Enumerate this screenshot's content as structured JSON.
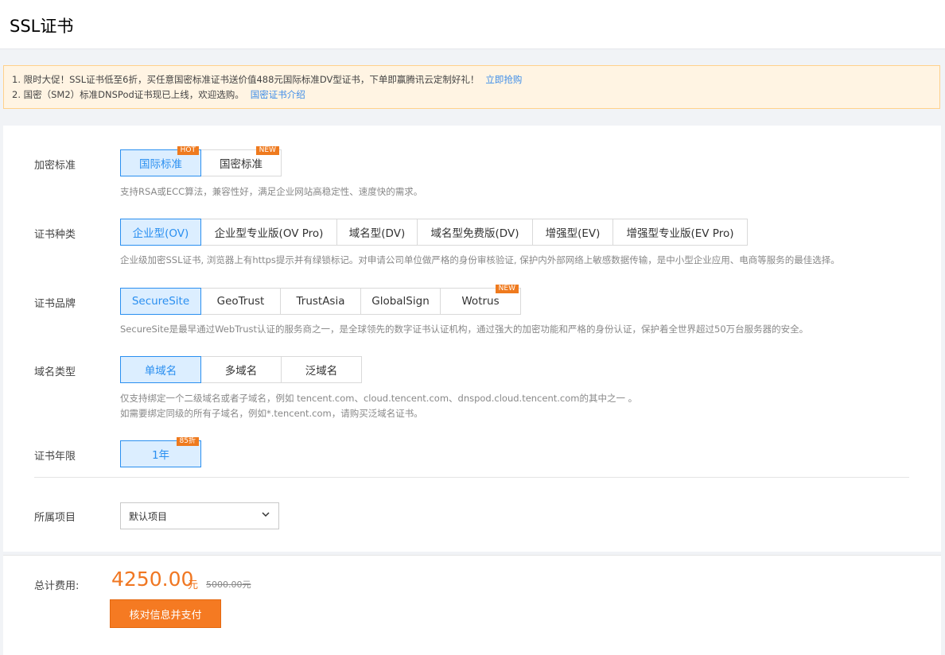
{
  "header": {
    "title": "SSL证书"
  },
  "notice": {
    "line1": "1. 限时大促！SSL证书低至6折，买任意国密标准证书送价值488元国际标准DV型证书，下单即赢腾讯云定制好礼！",
    "line1_link": "立即抢购",
    "line2": "2. 国密（SM2）标准DNSPod证书现已上线，欢迎选购。",
    "line2_link": "国密证书介绍"
  },
  "encryption": {
    "label": "加密标准",
    "options": [
      {
        "label": "国际标准",
        "tag": "HOT",
        "selected": true
      },
      {
        "label": "国密标准",
        "tag": "NEW",
        "selected": false
      }
    ],
    "desc": "支持RSA或ECC算法，兼容性好，满足企业网站高稳定性、速度快的需求。"
  },
  "cert_type": {
    "label": "证书种类",
    "options": [
      {
        "label": "企业型(OV)",
        "selected": true
      },
      {
        "label": "企业型专业版(OV Pro)",
        "selected": false
      },
      {
        "label": "域名型(DV)",
        "selected": false
      },
      {
        "label": "域名型免费版(DV)",
        "selected": false
      },
      {
        "label": "增强型(EV)",
        "selected": false
      },
      {
        "label": "增强型专业版(EV Pro)",
        "selected": false
      }
    ],
    "desc": "企业级加密SSL证书, 浏览器上有https提示并有绿锁标记。对申请公司单位做严格的身份审核验证, 保护内外部网络上敏感数据传输，是中小型企业应用、电商等服务的最佳选择。"
  },
  "brand": {
    "label": "证书品牌",
    "options": [
      {
        "label": "SecureSite",
        "selected": true
      },
      {
        "label": "GeoTrust",
        "selected": false
      },
      {
        "label": "TrustAsia",
        "selected": false
      },
      {
        "label": "GlobalSign",
        "selected": false
      },
      {
        "label": "Wotrus",
        "tag": "NEW",
        "selected": false
      }
    ],
    "desc": "SecureSite是最早通过WebTrust认证的服务商之一，是全球领先的数字证书认证机构，通过强大的加密功能和严格的身份认证，保护着全世界超过50万台服务器的安全。"
  },
  "domain_type": {
    "label": "域名类型",
    "options": [
      {
        "label": "单域名",
        "selected": true
      },
      {
        "label": "多域名",
        "selected": false
      },
      {
        "label": "泛域名",
        "selected": false
      }
    ],
    "desc1": "仅支持绑定一个二级域名或者子域名，例如 tencent.com、cloud.tencent.com、dnspod.cloud.tencent.com的其中之一 。",
    "desc2": "如需要绑定同级的所有子域名，例如*.tencent.com，请购买泛域名证书。"
  },
  "duration": {
    "label": "证书年限",
    "options": [
      {
        "label": "1年",
        "tag": "85折",
        "selected": true
      }
    ]
  },
  "project": {
    "label": "所属项目",
    "value": "默认项目"
  },
  "footer": {
    "total_label": "总计费用:",
    "price": "4250.00",
    "currency": "元",
    "original_price": "5000.00元",
    "pay_button": "核对信息并支付"
  },
  "colors": {
    "accent": "#2a8ff0",
    "accent_bg": "#dceeff",
    "price": "#f07722",
    "tag": "#ef7a1e",
    "notice_bg": "#fff4e3",
    "notice_border": "#ffd18b",
    "link": "#3f8ee8"
  }
}
